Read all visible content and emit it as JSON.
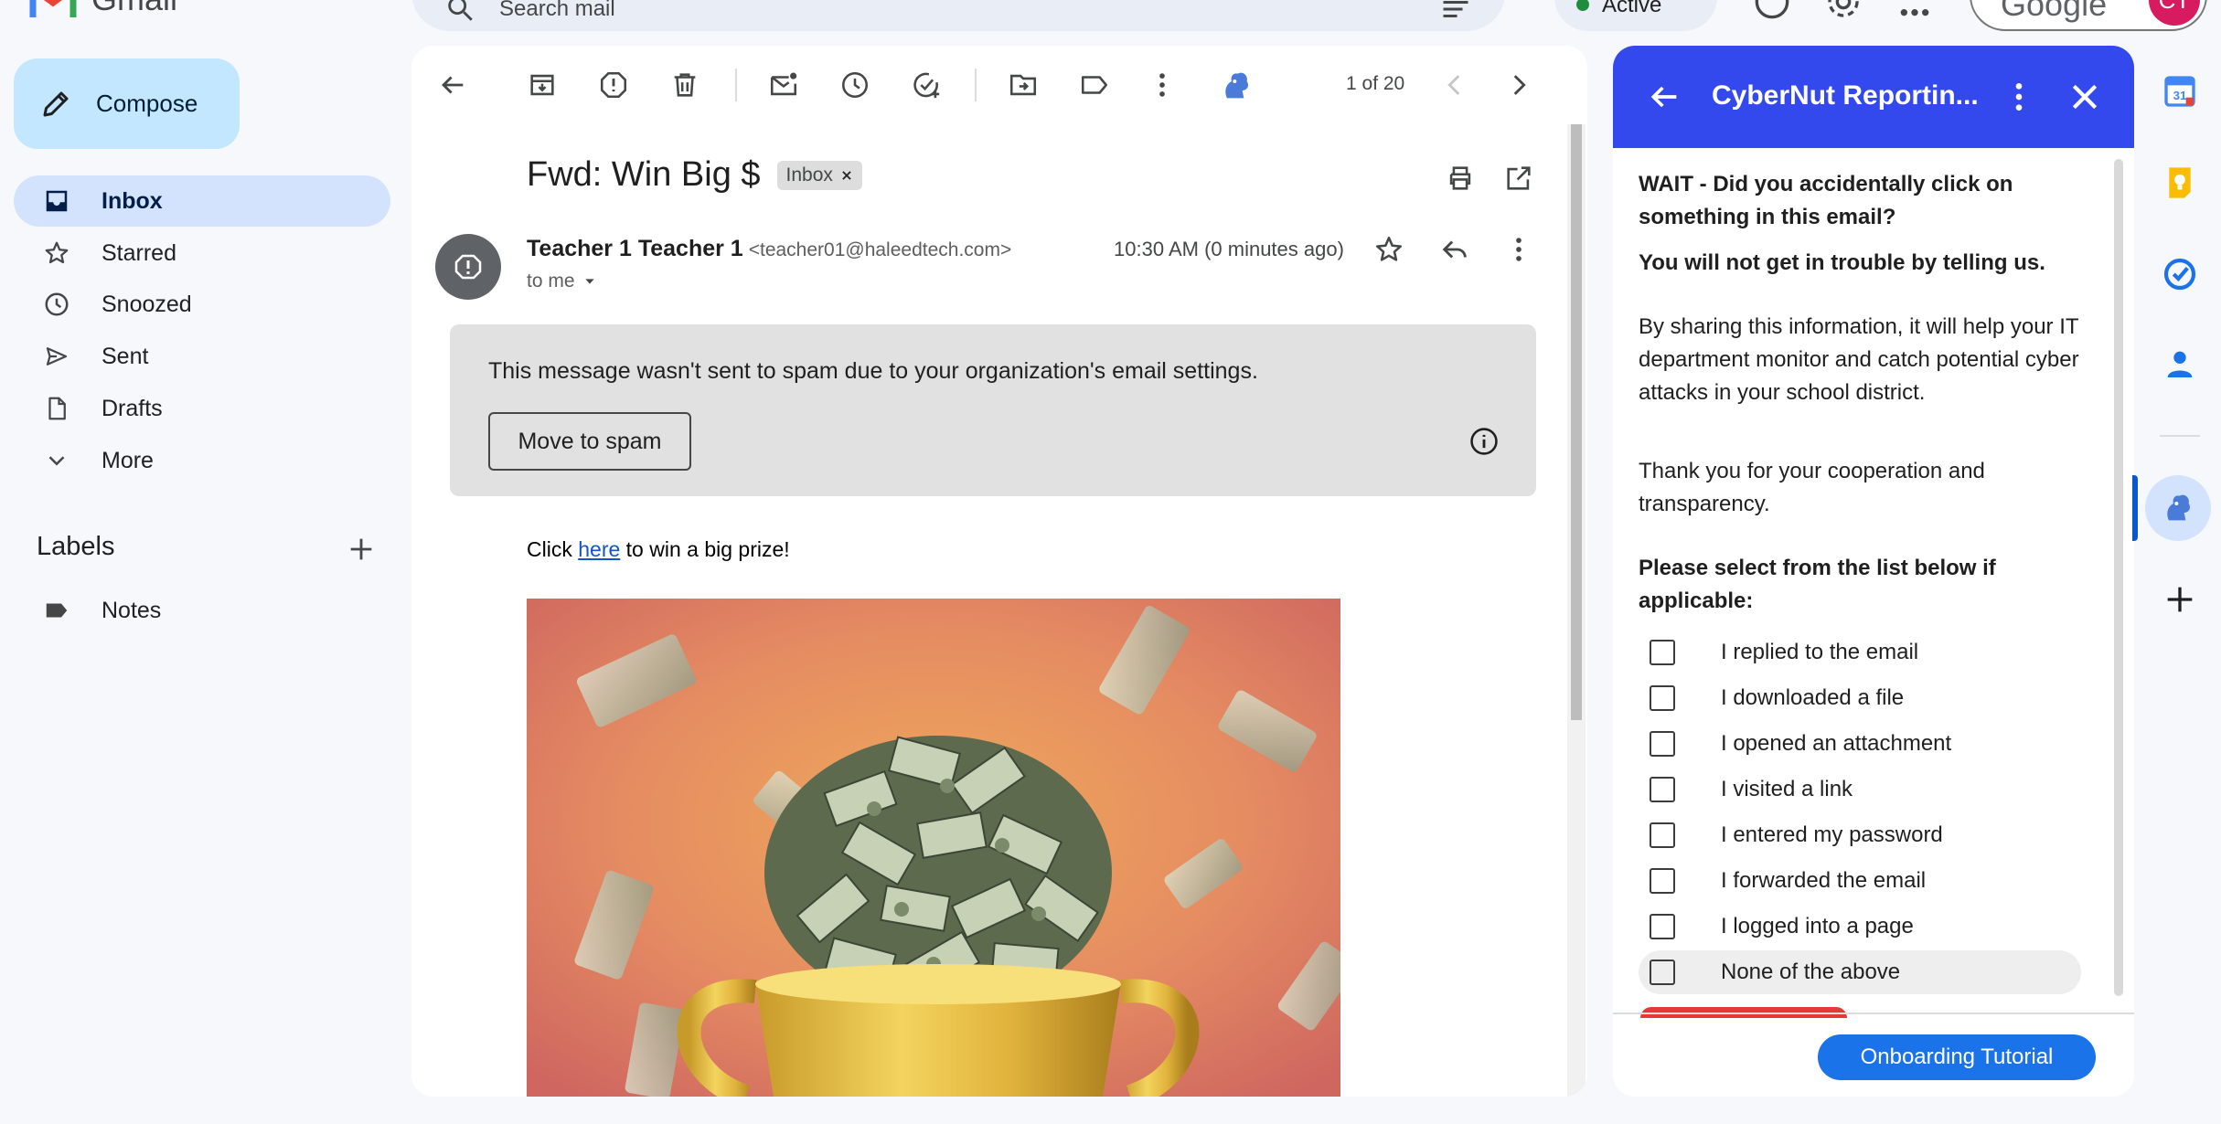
{
  "app": {
    "logo_text": "Gmail",
    "search_placeholder": "Search mail",
    "status": "Active",
    "account_brand": "Google",
    "avatar_initials": "CT"
  },
  "nav": {
    "compose": "Compose",
    "items": [
      {
        "label": "Inbox",
        "icon": "inbox-icon",
        "active": true
      },
      {
        "label": "Starred",
        "icon": "star-icon"
      },
      {
        "label": "Snoozed",
        "icon": "clock-icon"
      },
      {
        "label": "Sent",
        "icon": "send-icon"
      },
      {
        "label": "Drafts",
        "icon": "draft-icon"
      },
      {
        "label": "More",
        "icon": "chevron-down-icon"
      }
    ],
    "labels_heading": "Labels",
    "labels": [
      {
        "label": "Notes",
        "icon": "label-icon"
      }
    ]
  },
  "email": {
    "counter": "1 of 20",
    "subject": "Fwd: Win Big $",
    "chip": "Inbox",
    "sender_name": "Teacher 1 Teacher 1",
    "sender_email": "<teacher01@haleedtech.com>",
    "to": "to me",
    "time": "10:30 AM (0 minutes ago)",
    "warning": "This message wasn't sent to spam due to your organization's email settings.",
    "move_to_spam": "Move to spam",
    "body_before": "Click ",
    "body_link": "here",
    "body_after": " to win a big prize!"
  },
  "cybernut": {
    "title": "CyberNut Reportin...",
    "question": "WAIT - Did you accidentally click on something in this email?",
    "reassure": "You will not get in trouble by telling us.",
    "info": "By sharing this information, it will help your IT department monitor and catch potential cyber attacks in your school district.",
    "thanks": "Thank you for your cooperation and transparency.",
    "select_prompt": "Please select from the list below if applicable:",
    "options": [
      "I replied to the email",
      "I downloaded a file",
      "I opened an attachment",
      "I visited a link",
      "I entered my password",
      "I forwarded the email",
      "I logged into a page",
      "None of the above"
    ],
    "onboarding_button": "Onboarding Tutorial"
  },
  "colors": {
    "compose_bg": "#c2e7ff",
    "active_nav_bg": "#d3e3fd",
    "cybernut_header": "#3349ee",
    "primary_button": "#1a73e8",
    "link": "#1155cc"
  }
}
